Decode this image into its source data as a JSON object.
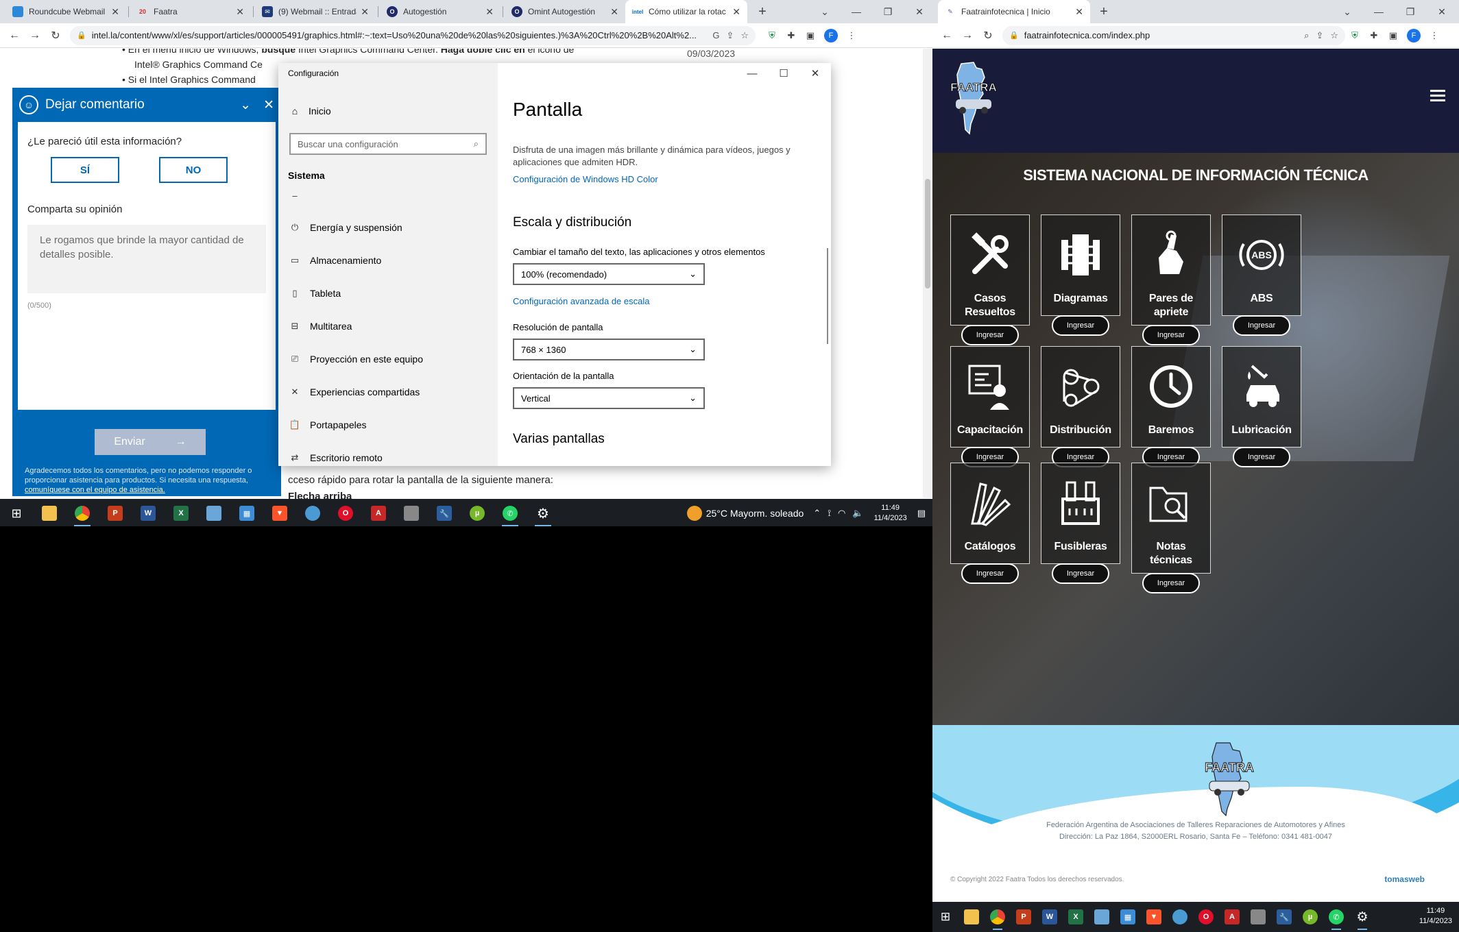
{
  "left_browser": {
    "tabs": [
      {
        "title": "Roundcube Webmail",
        "fav_color": "#2c88d9"
      },
      {
        "title": "Faatra",
        "fav_text": "20",
        "fav_color": "#d32f2f"
      },
      {
        "title": "(9) Webmail :: Entrada",
        "fav_color": "#1e3a7a"
      },
      {
        "title": "Autogestión",
        "fav_color": "#1e2a6a"
      },
      {
        "title": "Omint Autogestión",
        "fav_color": "#1e2a6a"
      },
      {
        "title": "Cómo utilizar la rotac",
        "fav_text": "intel",
        "fav_color": "#0068b5",
        "active": true
      }
    ],
    "url": "intel.la/content/www/xl/es/support/articles/000005491/graphics.html#:~:text=Uso%20una%20de%20las%20siguientes.)%3A%20Ctrl%20%2B%20Alt%2...",
    "avatar_letter": "F"
  },
  "intel_page": {
    "bullet1_pre": "En el menú inicio de Windows, ",
    "bullet1_bold": "busque",
    "bullet1_mid": " Intel Graphics Command Center. ",
    "bullet1_bold2": "Haga doble clic en",
    "bullet1_post": " el icono de",
    "bullet1_line2": "Intel® Graphics Command Ce",
    "bullet2": "Si el Intel Graphics Command",
    "date": "09/03/2023",
    "bottom_text": "cceso rápido para rotar la pantalla de la siguiente manera:",
    "bottom_bold": "Flecha arriba"
  },
  "feedback": {
    "title": "Dejar comentario",
    "question": "¿Le pareció útil esta información?",
    "yes": "SÍ",
    "no": "NO",
    "share": "Comparta su opinión",
    "placeholder": "Le rogamos que brinde la mayor cantidad de detalles posible.",
    "count": "(0/500)",
    "send": "Enviar",
    "footer_text": "Agradecemos todos los comentarios, pero no podemos responder o proporcionar asistencia para productos. Si necesita una respuesta,",
    "footer_link": "comuníquese con el equipo de asistencia."
  },
  "settings": {
    "window_title": "Configuración",
    "home": "Inicio",
    "search_placeholder": "Buscar una configuración",
    "section": "Sistema",
    "nav": [
      {
        "label": "Energía y suspensión",
        "icon": "power-icon"
      },
      {
        "label": "Almacenamiento",
        "icon": "storage-icon"
      },
      {
        "label": "Tableta",
        "icon": "tablet-icon"
      },
      {
        "label": "Multitarea",
        "icon": "multitask-icon"
      },
      {
        "label": "Proyección en este equipo",
        "icon": "projection-icon"
      },
      {
        "label": "Experiencias compartidas",
        "icon": "shared-icon"
      },
      {
        "label": "Portapapeles",
        "icon": "clipboard-icon"
      },
      {
        "label": "Escritorio remoto",
        "icon": "remote-icon"
      }
    ],
    "page_title": "Pantalla",
    "hdr_text": "Disfruta de una imagen más brillante y dinámica para vídeos, juegos y aplicaciones que admiten HDR.",
    "hdr_link": "Configuración de Windows HD Color",
    "scale_heading": "Escala y distribución",
    "scale_label": "Cambiar el tamaño del texto, las aplicaciones y otros elementos",
    "scale_value": "100% (recomendado)",
    "scale_link": "Configuración avanzada de escala",
    "res_label": "Resolución de pantalla",
    "res_value": "768 × 1360",
    "orient_label": "Orientación de la pantalla",
    "orient_value": "Vertical",
    "multi_heading": "Varias pantallas"
  },
  "taskbar_left": {
    "weather": "25°C  Mayorm. soleado",
    "time": "11:49",
    "date": "11/4/2023"
  },
  "right_browser": {
    "tab_title": "Faatrainfotecnica | Inicio",
    "url": "faatrainfotecnica.com/index.php",
    "avatar_letter": "F"
  },
  "faatra": {
    "hero_title": "SISTEMA NACIONAL DE INFORMACIÓN TÉCNICA",
    "button_label": "Ingresar",
    "cards": [
      {
        "label": "Casos Resueltos",
        "icon": "tools-icon"
      },
      {
        "label": "Diagramas",
        "icon": "diagram-icon"
      },
      {
        "label": "Pares de apriete",
        "icon": "torque-icon"
      },
      {
        "label": "ABS",
        "icon": "abs-icon"
      },
      {
        "label": "Capacitación",
        "icon": "training-icon"
      },
      {
        "label": "Distribución",
        "icon": "timing-belt-icon"
      },
      {
        "label": "Baremos",
        "icon": "clock-icon"
      },
      {
        "label": "Lubricación",
        "icon": "oil-icon"
      },
      {
        "label": "Catálogos",
        "icon": "catalog-icon"
      },
      {
        "label": "Fusibleras",
        "icon": "fuse-icon"
      },
      {
        "label": "Notas técnicas",
        "icon": "notes-icon"
      }
    ],
    "footer_line1": "Federación Argentina de Asociaciones de Talleres Reparaciones de Automotores y Afines",
    "footer_line2": "Dirección: La Paz 1864, S2000ERL Rosario, Santa Fe – Teléfono: 0341 481-0047",
    "copyright": "© Copyright 2022 Faatra Todos los derechos reservados.",
    "credit": "tomasweb",
    "logo_text": "FAATRA"
  },
  "taskbar_right": {
    "time": "11:49",
    "date": "11/4/2023"
  }
}
